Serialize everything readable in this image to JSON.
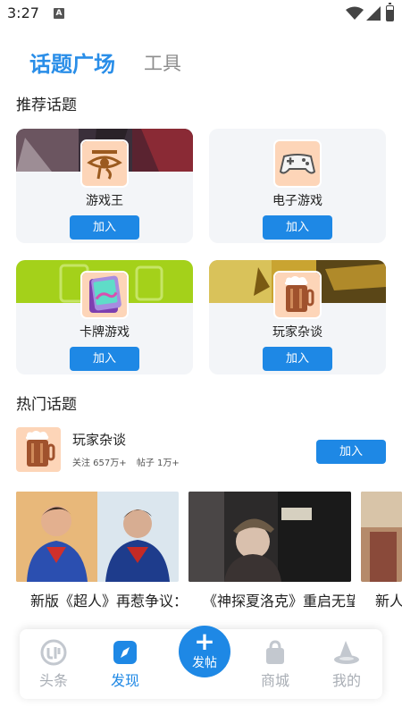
{
  "status_bar": {
    "time": "3:27",
    "notification_letter": "A"
  },
  "top_tabs": [
    {
      "label": "话题广场",
      "active": true
    },
    {
      "label": "工具",
      "active": false
    }
  ],
  "recommended": {
    "title": "推荐话题",
    "topics": [
      {
        "name": "游戏王",
        "join_label": "加入",
        "icon": "eye-of-horus-icon"
      },
      {
        "name": "电子游戏",
        "join_label": "加入",
        "icon": "gamepad-icon"
      },
      {
        "name": "卡牌游戏",
        "join_label": "加入",
        "icon": "card-deck-icon"
      },
      {
        "name": "玩家杂谈",
        "join_label": "加入",
        "icon": "beer-mug-icon"
      }
    ]
  },
  "hot": {
    "title": "热门话题",
    "topic": {
      "name": "玩家杂谈",
      "followers": "关注 657万+",
      "posts": "帖子 1万+",
      "join_label": "加入",
      "icon": "beer-mug-icon"
    },
    "posts": [
      {
        "title": "新版《超人》再惹争议：导演承认讲的是移"
      },
      {
        "title": "《神探夏洛克》重启无望？主创直言“何必炒"
      },
      {
        "title": "新人"
      }
    ]
  },
  "bottom_nav": {
    "items": [
      {
        "label": "头条",
        "icon": "headline-logo-icon",
        "active": false
      },
      {
        "label": "发现",
        "icon": "compass-icon",
        "active": true
      },
      {
        "label": "商城",
        "icon": "shopping-bag-icon",
        "active": false
      },
      {
        "label": "我的",
        "icon": "wizard-hat-icon",
        "active": false
      }
    ],
    "post_button": {
      "symbol": "+",
      "label": "发帖"
    }
  },
  "colors": {
    "accent": "#1e88e5",
    "tab_active": "#2a8ee8",
    "tab_inactive": "#8d8d8d",
    "card_background": "#f3f5f8",
    "nav_inactive": "#a9aeb5"
  }
}
